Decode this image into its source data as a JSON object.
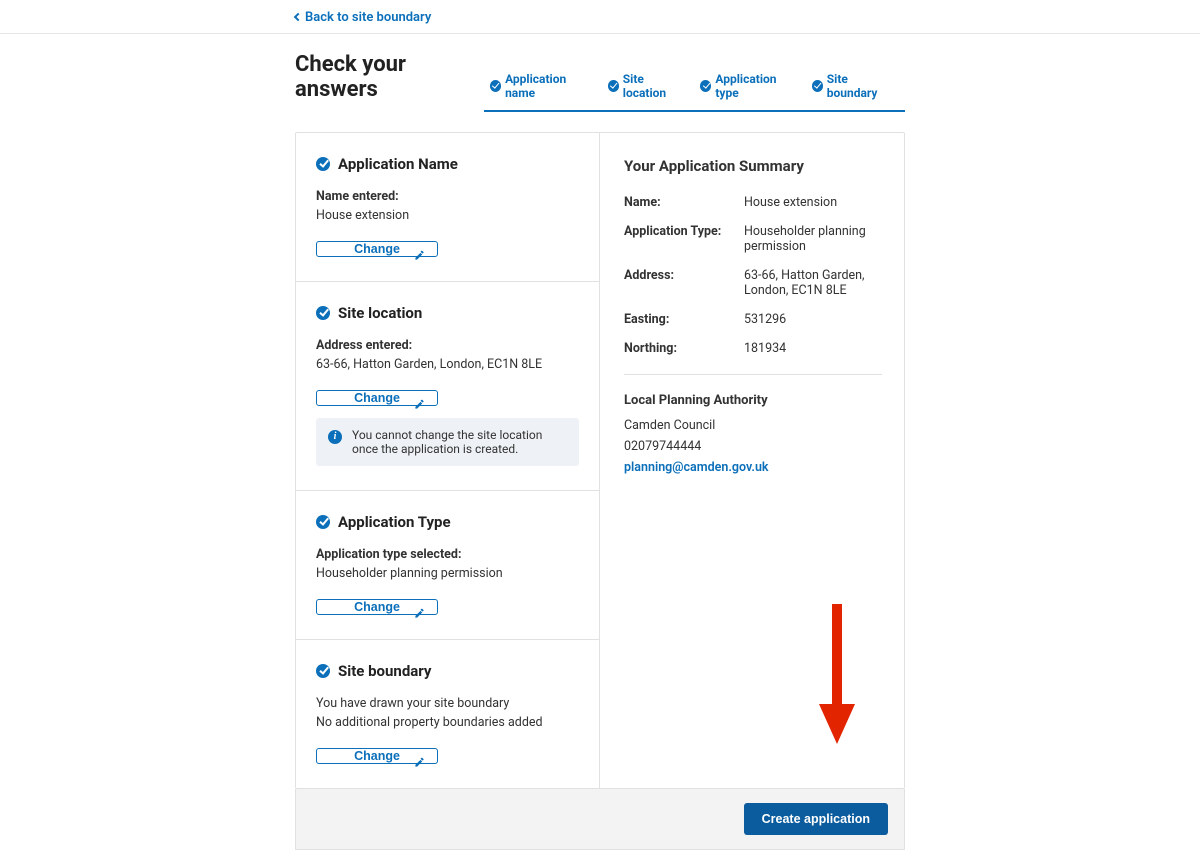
{
  "back_link": "Back to site boundary",
  "page_title": "Check your answers",
  "tabs": [
    {
      "label": "Application name"
    },
    {
      "label": "Site location"
    },
    {
      "label": "Application type"
    },
    {
      "label": "Site boundary"
    }
  ],
  "change_label": "Change",
  "sections": {
    "app_name": {
      "title": "Application Name",
      "field_label": "Name entered:",
      "field_value": "House extension"
    },
    "site_location": {
      "title": "Site location",
      "field_label": "Address entered:",
      "field_value": "63-66, Hatton Garden, London, EC1N 8LE",
      "info": "You cannot change the site location once the application is created."
    },
    "app_type": {
      "title": "Application Type",
      "field_label": "Application type selected:",
      "field_value": "Householder planning permission"
    },
    "site_boundary": {
      "title": "Site boundary",
      "line1": "You have drawn your site boundary",
      "line2": "No additional property boundaries added"
    }
  },
  "summary": {
    "title": "Your Application Summary",
    "rows": {
      "name_k": "Name:",
      "name_v": "House extension",
      "type_k": "Application Type:",
      "type_v": "Householder planning permission",
      "addr_k": "Address:",
      "addr_v": "63-66, Hatton Garden, London, EC1N 8LE",
      "east_k": "Easting:",
      "east_v": "531296",
      "north_k": "Northing:",
      "north_v": "181934"
    },
    "lpa_title": "Local Planning Authority",
    "lpa_name": "Camden Council",
    "lpa_phone": "02079744444",
    "lpa_email": "planning@camden.gov.uk"
  },
  "create_button": "Create application"
}
